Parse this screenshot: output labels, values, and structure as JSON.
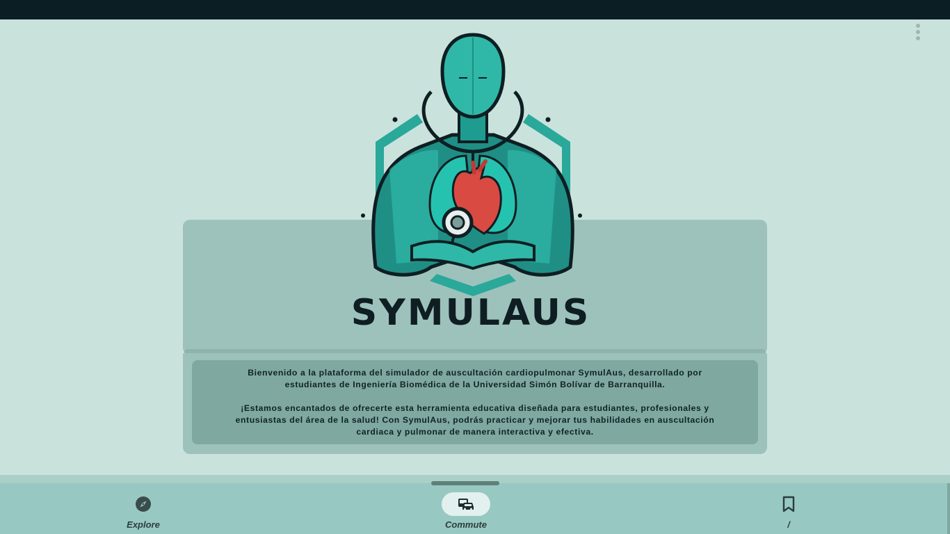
{
  "app": {
    "brand": "SYMULAUS"
  },
  "intro": {
    "paragraph_1": "Bienvenido a la plataforma del simulador de auscultación cardiopulmonar SymulAus, desarrollado por estudiantes de Ingeniería Biomédica de la Universidad Simón Bolívar de Barranquilla.",
    "paragraph_2": "¡Estamos encantados de ofrecerte esta herramienta educativa diseñada para estudiantes, profesionales y entusiastas del área de la salud! Con SymulAus, podrás practicar y mejorar tus habilidades en auscultación cardiaca y pulmonar de manera interactiva y efectiva."
  },
  "menu": {
    "icon": "more-vert-icon"
  },
  "bottom_nav": {
    "items": [
      {
        "label": "Explore",
        "icon": "compass-icon",
        "active": false
      },
      {
        "label": "Commute",
        "icon": "commute-icon",
        "active": true
      },
      {
        "label": "/",
        "icon": "bookmark-icon",
        "active": false
      }
    ]
  },
  "colors": {
    "background": "#c9e3dc",
    "status_bar": "#0a1e24",
    "card": "#9dc2bb",
    "card_inner": "#7ea8a0",
    "nav": "#98c8c2",
    "teal_accent": "#2fb8a8",
    "heart_red": "#d94a43"
  }
}
